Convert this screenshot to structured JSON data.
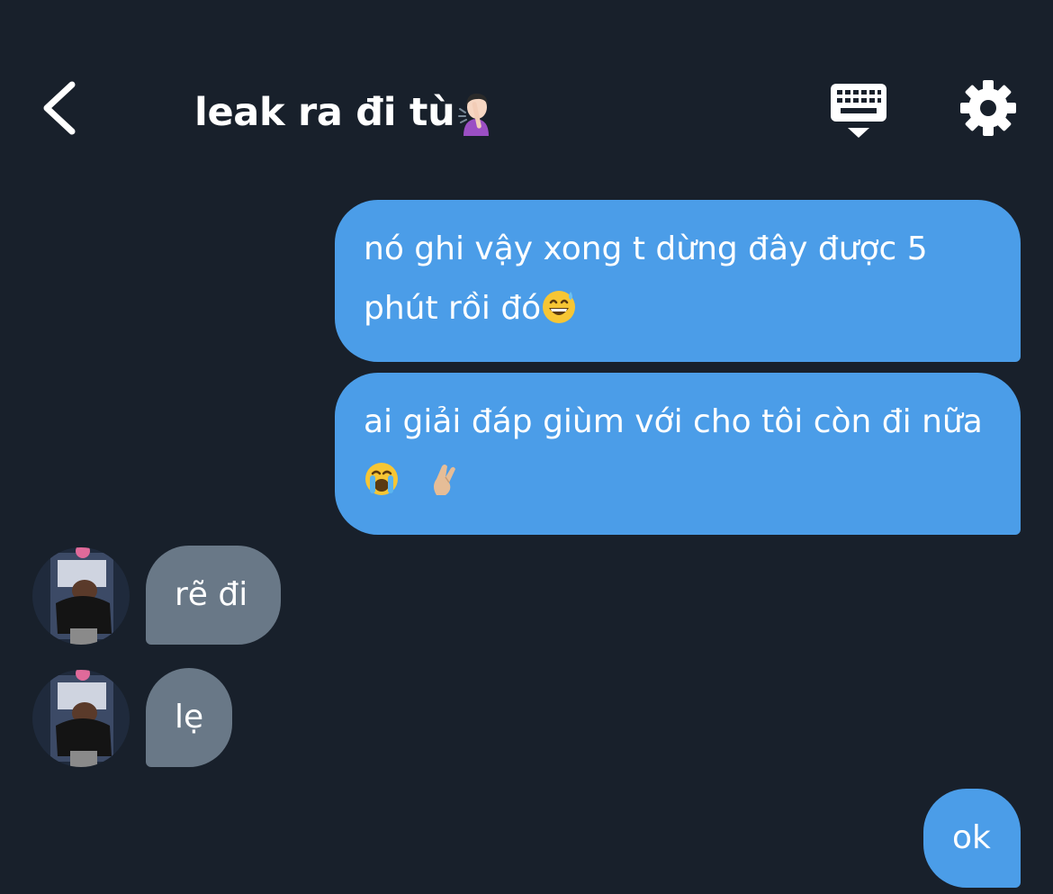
{
  "header": {
    "title": "leak ra đi tù",
    "back_icon": "chevron-left-icon",
    "keyboard_icon": "keyboard-icon",
    "settings_icon": "gear-icon"
  },
  "messages": [
    {
      "direction": "outgoing",
      "text": "nó ghi vậy xong t dừng đây được 5 phút rồi đó",
      "emoji": "grinning-sweat-emoji"
    },
    {
      "direction": "outgoing",
      "text": "ai giải đáp giùm với cho tôi còn đi nữa",
      "emoji": "loudly-crying-emoji, crossed-fingers-emoji"
    },
    {
      "direction": "incoming",
      "text": "rẽ đi"
    },
    {
      "direction": "incoming",
      "text": "lẹ"
    },
    {
      "direction": "outgoing",
      "text": "ok"
    }
  ],
  "colors": {
    "background": "#18202b",
    "outgoing_bubble": "#4b9de8",
    "incoming_bubble": "#697887",
    "text": "#ffffff"
  }
}
